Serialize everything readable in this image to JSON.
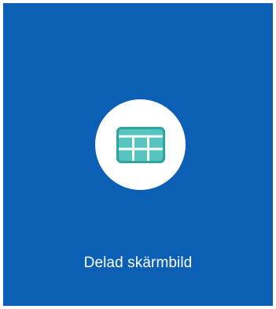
{
  "tile": {
    "label": "Delad skärmbild",
    "icon": "grid-layout-icon",
    "colors": {
      "background": "#0b60b6",
      "circle": "#ffffff",
      "icon_fill": "#58c4bf",
      "icon_stroke": "#2aa69f",
      "label_text": "#ffffff"
    }
  }
}
